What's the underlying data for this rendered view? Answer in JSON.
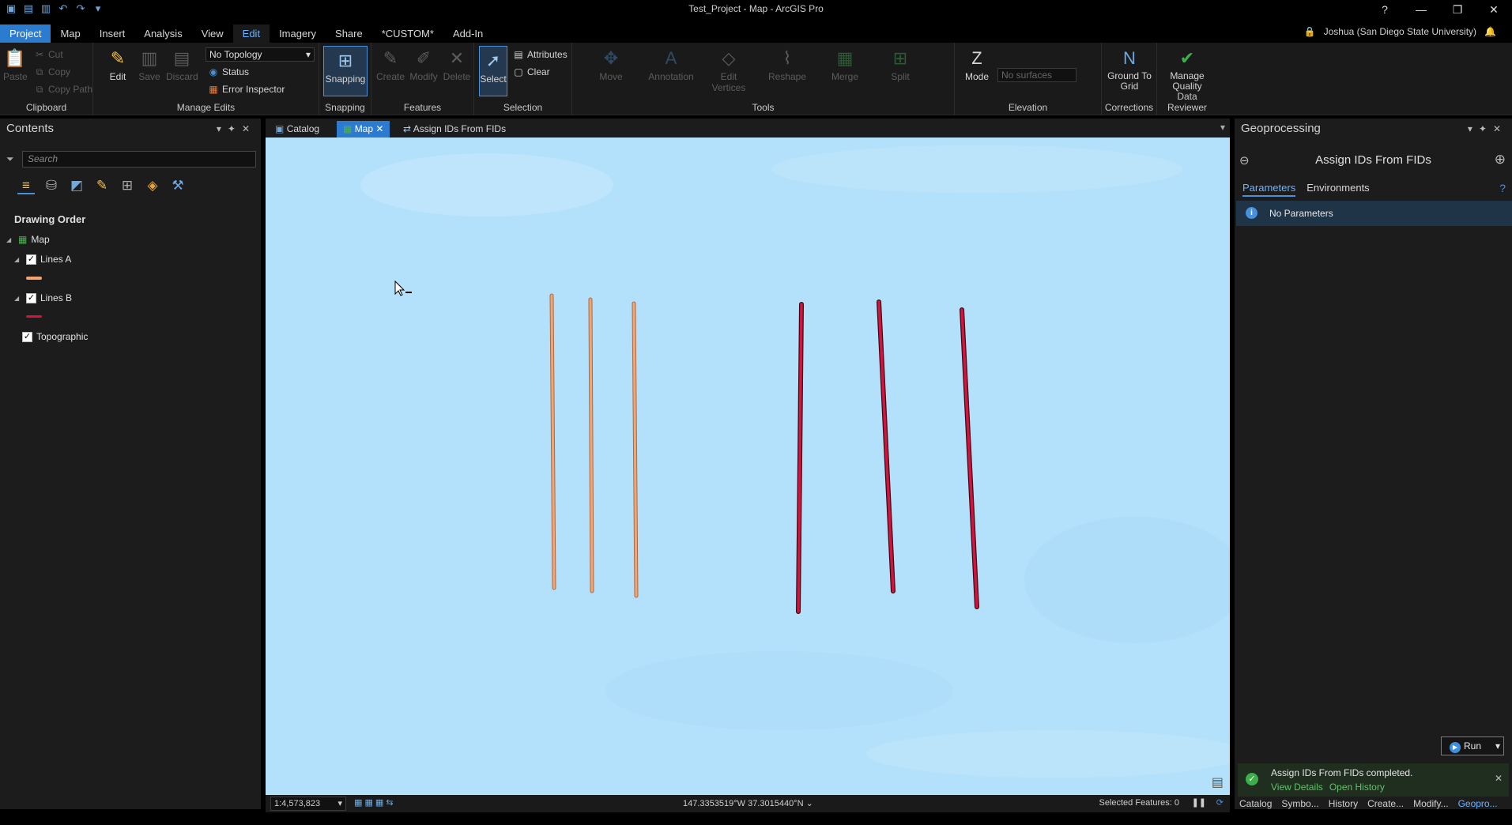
{
  "window": {
    "title": "Test_Project - Map - ArcGIS Pro",
    "help": "?",
    "minimize": "—",
    "restore": "❐",
    "close": "✕"
  },
  "ribbon_tabs": [
    "Project",
    "Map",
    "Insert",
    "Analysis",
    "View",
    "Edit",
    "Imagery",
    "Share",
    "*CUSTOM*",
    "Add-In"
  ],
  "user": {
    "name": "Joshua (San Diego State University)"
  },
  "clipboard": {
    "paste": "Paste",
    "cut": "Cut",
    "copy": "Copy",
    "copy_path": "Copy Path",
    "label": "Clipboard"
  },
  "manage_edits": {
    "edit": "Edit",
    "save": "Save",
    "discard": "Discard",
    "topology": "No Topology",
    "status": "Status",
    "error_inspector": "Error Inspector",
    "label": "Manage Edits"
  },
  "snapping": {
    "button": "Snapping",
    "label": "Snapping"
  },
  "features": {
    "create": "Create",
    "modify": "Modify",
    "delete": "Delete",
    "label": "Features"
  },
  "selection": {
    "select": "Select",
    "attributes": "Attributes",
    "clear": "Clear",
    "label": "Selection"
  },
  "tools": {
    "move": "Move",
    "annotation": "Annotation",
    "edit_vertices": "Edit Vertices",
    "reshape": "Reshape",
    "merge": "Merge",
    "split": "Split",
    "label": "Tools"
  },
  "elevation": {
    "mode": "Mode",
    "surfaces_placeholder": "No surfaces",
    "label": "Elevation"
  },
  "corrections": {
    "ground_to_grid": "Ground To Grid",
    "label": "Corrections"
  },
  "data_reviewer": {
    "manage_quality": "Manage Quality",
    "label": "Data Reviewer"
  },
  "contents": {
    "title": "Contents",
    "search_placeholder": "Search",
    "drawing_order": "Drawing Order",
    "layers": [
      {
        "name": "Map"
      },
      {
        "name": "Lines A",
        "color": "#f4a46f"
      },
      {
        "name": "Lines B",
        "color": "#d4143f"
      },
      {
        "name": "Topographic"
      }
    ]
  },
  "view_tabs": [
    "Catalog",
    "Map",
    "Assign IDs From FIDs"
  ],
  "status_bar": {
    "scale": "1:4,573,823",
    "coords": "147.3353519°W 37.3015440°N",
    "selected": "Selected Features: 0"
  },
  "geoprocessing": {
    "title": "Geoprocessing",
    "tool": "Assign IDs From FIDs",
    "tabs": [
      "Parameters",
      "Environments"
    ],
    "no_params": "No Parameters",
    "run": "Run",
    "toast": {
      "message": "Assign IDs From FIDs completed.",
      "view_details": "View Details",
      "open_history": "Open History"
    }
  },
  "bottom_tabs": [
    "Catalog",
    "Symbo...",
    "History",
    "Create...",
    "Modify...",
    "Geopro..."
  ]
}
